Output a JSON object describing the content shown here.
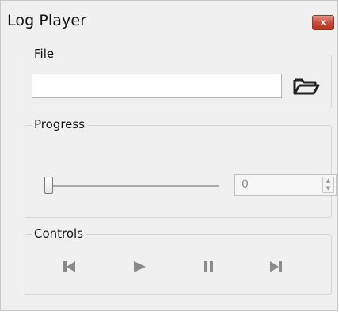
{
  "window": {
    "title": "Log Player",
    "close_glyph": "x"
  },
  "file": {
    "group_label": "File",
    "path_value": "",
    "browse_icon": "folder-open-icon"
  },
  "progress": {
    "group_label": "Progress",
    "slider_position": 0,
    "spin_value": "0"
  },
  "controls": {
    "group_label": "Controls",
    "buttons": [
      {
        "icon": "skip-back-icon"
      },
      {
        "icon": "play-icon"
      },
      {
        "icon": "pause-icon"
      },
      {
        "icon": "skip-forward-icon"
      }
    ],
    "icon_color": "#8a8a8a"
  },
  "colors": {
    "close_button": "#c64b3b",
    "background": "#f0f0f0"
  }
}
